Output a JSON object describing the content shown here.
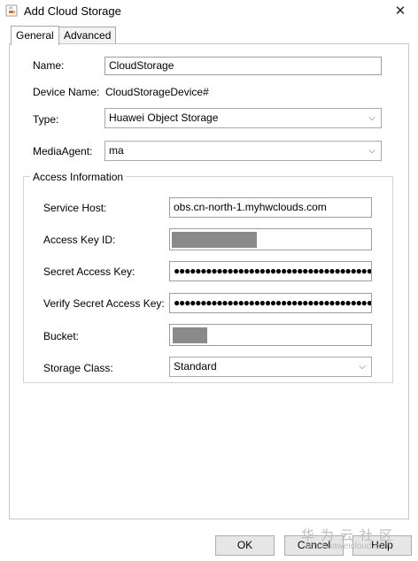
{
  "window": {
    "title": "Add Cloud Storage",
    "app_icon": "java-coffee-cup-icon",
    "close_glyph": "✕"
  },
  "tabs": [
    {
      "label": "General",
      "active": true
    },
    {
      "label": "Advanced",
      "active": false
    }
  ],
  "general": {
    "name_label": "Name:",
    "name_value": "CloudStorage",
    "device_name_label": "Device Name:",
    "device_name_value": "CloudStorageDevice#",
    "type_label": "Type:",
    "type_value": "Huawei Object Storage",
    "media_agent_label": "MediaAgent:",
    "media_agent_value": "ma"
  },
  "access": {
    "group_title": "Access Information",
    "service_host_label": "Service Host:",
    "service_host_value": "obs.cn-north-1.myhwclouds.com",
    "access_key_id_label": "Access Key ID:",
    "secret_access_key_label": "Secret Access Key:",
    "secret_access_key_value": "●●●●●●●●●●●●●●●●●●●●●●●●●●●●●●●●●●●●●●●●●●●●●●●",
    "verify_secret_label": "Verify Secret Access Key:",
    "verify_secret_value": "●●●●●●●●●●●●●●●●●●●●●●●●●●●●●●●●●●●●●●●●●●●●●●●",
    "bucket_label": "Bucket:",
    "storage_class_label": "Storage Class:",
    "storage_class_value": "Standard"
  },
  "buttons": {
    "ok": "OK",
    "cancel": "Cancel",
    "help": "Help"
  },
  "watermark": {
    "text_cn": "华为云社区",
    "url": "bbs.huaweicloud.com"
  },
  "colors": {
    "mask": "#8a8a8a",
    "field_border": "#9d9d9d",
    "button_bg": "#e6e6e6"
  }
}
